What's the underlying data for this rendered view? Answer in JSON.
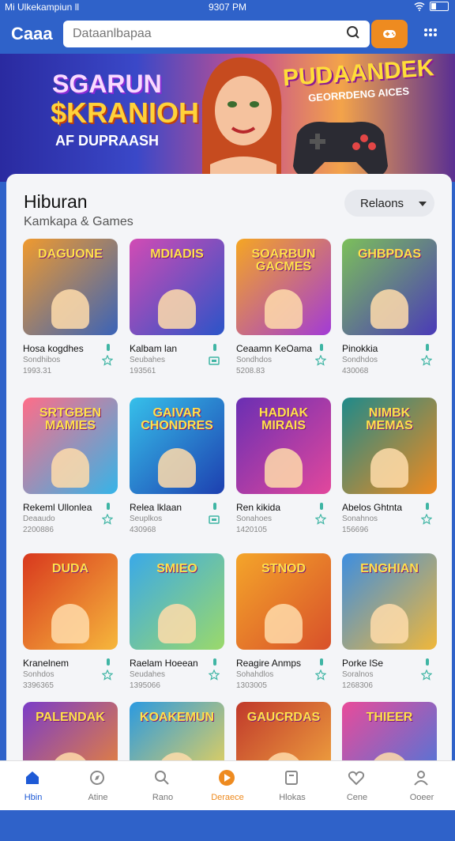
{
  "status": {
    "carrier": "Mi Ulkekampiun ll",
    "time": "9307 PM"
  },
  "header": {
    "logo": "Caaa",
    "search_placeholder": "Dataanlbapaa"
  },
  "banner": {
    "headline_1": "SGARUN",
    "headline_2": "$KRANIOH",
    "tagline": "AF DUPRAASH",
    "promo_title": "PUDAANDEK",
    "promo_subtitle": "GEORRDENG AICES"
  },
  "section": {
    "title": "Hiburan",
    "subtitle": "Kamkapa & Games",
    "filter_label": "Relaons"
  },
  "games": [
    {
      "title": "Hosa kogdhes",
      "cat": "Sondhibos",
      "meta": "1993.31",
      "art": "DAGUONE",
      "c1": "#f09a2e",
      "c2": "#3a63b8",
      "icon": "star"
    },
    {
      "title": "Kalbam lan",
      "cat": "Seubahes",
      "meta": "193561",
      "art": "MDIADIS",
      "c1": "#d24bb4",
      "c2": "#2b54c8",
      "icon": "ad"
    },
    {
      "title": "Ceaamn KeOama",
      "cat": "Sondhdos",
      "meta": "5208.83",
      "art": "SOARBUN GACMES",
      "c1": "#f5a623",
      "c2": "#a23bd6",
      "icon": "star"
    },
    {
      "title": "Pinokkia",
      "cat": "Sondhdos",
      "meta": "430068",
      "art": "GHBPDAS",
      "c1": "#7cc05a",
      "c2": "#4a3ab8",
      "icon": "star"
    },
    {
      "title": "Rekeml Ullonlea",
      "cat": "Deaaudo",
      "meta": "2200886",
      "art": "SRTGBEN MAMIES",
      "c1": "#ff6d88",
      "c2": "#35b4e8",
      "icon": "star"
    },
    {
      "title": "Relea lklaan",
      "cat": "Seuplkos",
      "meta": "430968",
      "art": "GAIVAR CHONDRES",
      "c1": "#36c0ea",
      "c2": "#1d3fb0",
      "icon": "ad"
    },
    {
      "title": "Ren kikida",
      "cat": "Sonahoes",
      "meta": "1420105",
      "art": "HADIAK MIRAIS",
      "c1": "#6a2fb3",
      "c2": "#e2479c",
      "icon": "star"
    },
    {
      "title": "Abelos Ghtnta",
      "cat": "Sonahnos",
      "meta": "156696",
      "art": "NIMBK MEMAS",
      "c1": "#1f8a8a",
      "c2": "#f08a1e",
      "icon": "star"
    },
    {
      "title": "Kranelnem",
      "cat": "Sonhdos",
      "meta": "3396365",
      "art": "DUDA",
      "c1": "#d8381e",
      "c2": "#f6b73c",
      "icon": "star"
    },
    {
      "title": "Raelam Hoeean",
      "cat": "Seudahes",
      "meta": "1395066",
      "art": "SMIEO",
      "c1": "#3aa9e8",
      "c2": "#9bd96a",
      "icon": "star"
    },
    {
      "title": "Reagire Anmps",
      "cat": "Sohahdlos",
      "meta": "1303005",
      "art": "STNOD",
      "c1": "#f4a52a",
      "c2": "#d8502a",
      "icon": "star"
    },
    {
      "title": "Porke lSe",
      "cat": "Soralnos",
      "meta": "1268306",
      "art": "ENGHIAN",
      "c1": "#3d8ee0",
      "c2": "#f0b73a",
      "icon": "star"
    },
    {
      "title": "",
      "cat": "",
      "meta": "",
      "art": "PALENDAK",
      "c1": "#7b3cc8",
      "c2": "#f38b2a",
      "icon": ""
    },
    {
      "title": "",
      "cat": "",
      "meta": "",
      "art": "KOAKEMUN",
      "c1": "#2b9ae0",
      "c2": "#ffd84a",
      "icon": ""
    },
    {
      "title": "",
      "cat": "",
      "meta": "",
      "art": "GAUCRDAS",
      "c1": "#c0392b",
      "c2": "#f5b041",
      "icon": ""
    },
    {
      "title": "",
      "cat": "",
      "meta": "",
      "art": "THIEER",
      "c1": "#e94b9a",
      "c2": "#3b7be0",
      "icon": ""
    }
  ],
  "nav": [
    {
      "label": "Hbin",
      "icon": "home-icon"
    },
    {
      "label": "Atine",
      "icon": "compass-icon"
    },
    {
      "label": "Rano",
      "icon": "search-icon"
    },
    {
      "label": "Deraece",
      "icon": "play-icon"
    },
    {
      "label": "Hlokas",
      "icon": "library-icon"
    },
    {
      "label": "Cene",
      "icon": "heart-icon"
    },
    {
      "label": "Ooeer",
      "icon": "profile-icon"
    }
  ],
  "colors": {
    "primary": "#2f62c9",
    "accent": "#ee8b20",
    "active": "#1e5ad6"
  }
}
